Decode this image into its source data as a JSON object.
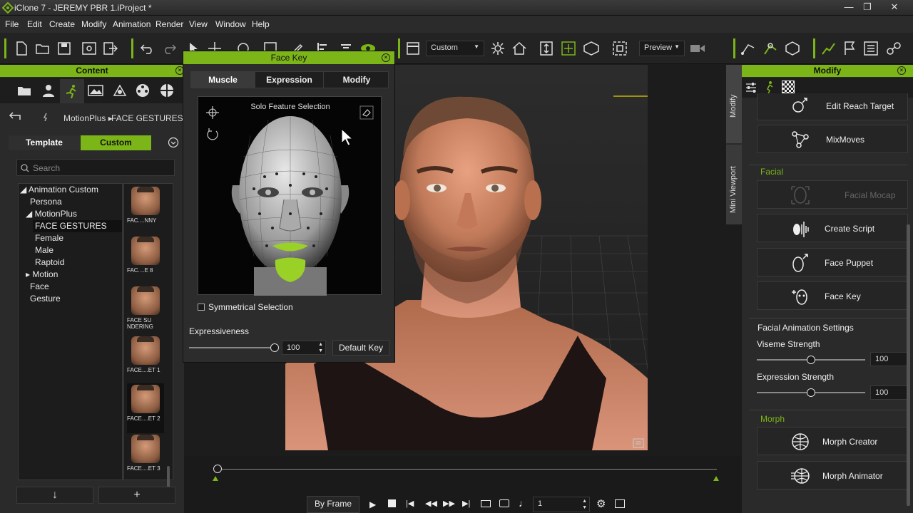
{
  "window": {
    "title": "iClone 7 - JEREMY PBR 1.iProject *"
  },
  "menu": [
    "File",
    "Edit",
    "Create",
    "Modify",
    "Animation",
    "Render",
    "View",
    "Window",
    "Help"
  ],
  "toolbar": {
    "camera_dropdown": "Custom",
    "preview_dropdown": "Preview"
  },
  "content_panel": {
    "title": "Content",
    "breadcrumb": [
      "MotionPlus ▸",
      "FACE GESTURES"
    ],
    "tabs": [
      "Template",
      "Custom"
    ],
    "active_tab": "Custom",
    "search_placeholder": "Search",
    "tree": [
      {
        "label": "◢ Animation Custom",
        "indent": 0
      },
      {
        "label": "Persona",
        "indent": 1
      },
      {
        "label": "◢ MotionPlus",
        "indent": 1
      },
      {
        "label": "FACE GESTURES",
        "indent": 2,
        "selected": true
      },
      {
        "label": "Female",
        "indent": 2
      },
      {
        "label": "Male",
        "indent": 2
      },
      {
        "label": "Raptoid",
        "indent": 2
      },
      {
        "label": "▸ Motion",
        "indent": 1
      },
      {
        "label": "Face",
        "indent": 1
      },
      {
        "label": "Gesture",
        "indent": 1
      }
    ],
    "thumbnails": [
      "FAC....NNY",
      "FAC....E 8",
      "FACE SU\nNDERING",
      "FACE....ET 1",
      "FACE....ET 2",
      "FACE....ET 3"
    ],
    "bottom_buttons": [
      "↓",
      "+"
    ]
  },
  "face_key": {
    "title": "Face Key",
    "tabs": [
      "Muscle",
      "Expression",
      "Modify"
    ],
    "active_tab": "Muscle",
    "view_title": "Solo Feature Selection",
    "symmetrical_label": "Symmetrical Selection",
    "expressiveness_label": "Expressiveness",
    "expressiveness_value": "100",
    "expressiveness_level": 1.0,
    "default_key_label": "Default Key"
  },
  "side_tabs": [
    "Modify",
    "Mini Viewport"
  ],
  "timeline": {
    "by_frame_label": "By Frame",
    "frame_value": "1"
  },
  "modify_panel": {
    "title": "Modify",
    "top_buttons": [
      "Edit Reach Target",
      "MixMoves"
    ],
    "facial_section": "Facial",
    "facial_buttons": [
      {
        "label": "Facial Mocap",
        "disabled": true
      },
      {
        "label": "Create Script",
        "disabled": false
      },
      {
        "label": "Face Puppet",
        "disabled": false
      },
      {
        "label": "Face Key",
        "disabled": false
      }
    ],
    "facial_settings_section": "Facial Animation Settings",
    "viseme_label": "Viseme Strength",
    "viseme_value": "100",
    "viseme_level": 0.5,
    "expression_label": "Expression Strength",
    "expression_value": "100",
    "expression_level": 0.5,
    "morph_section": "Morph",
    "morph_buttons": [
      "Morph Creator",
      "Morph Animator"
    ]
  },
  "colors": {
    "accent": "#7cb518",
    "panel": "#2a2a2a",
    "lip_highlight": "#9ad126"
  }
}
